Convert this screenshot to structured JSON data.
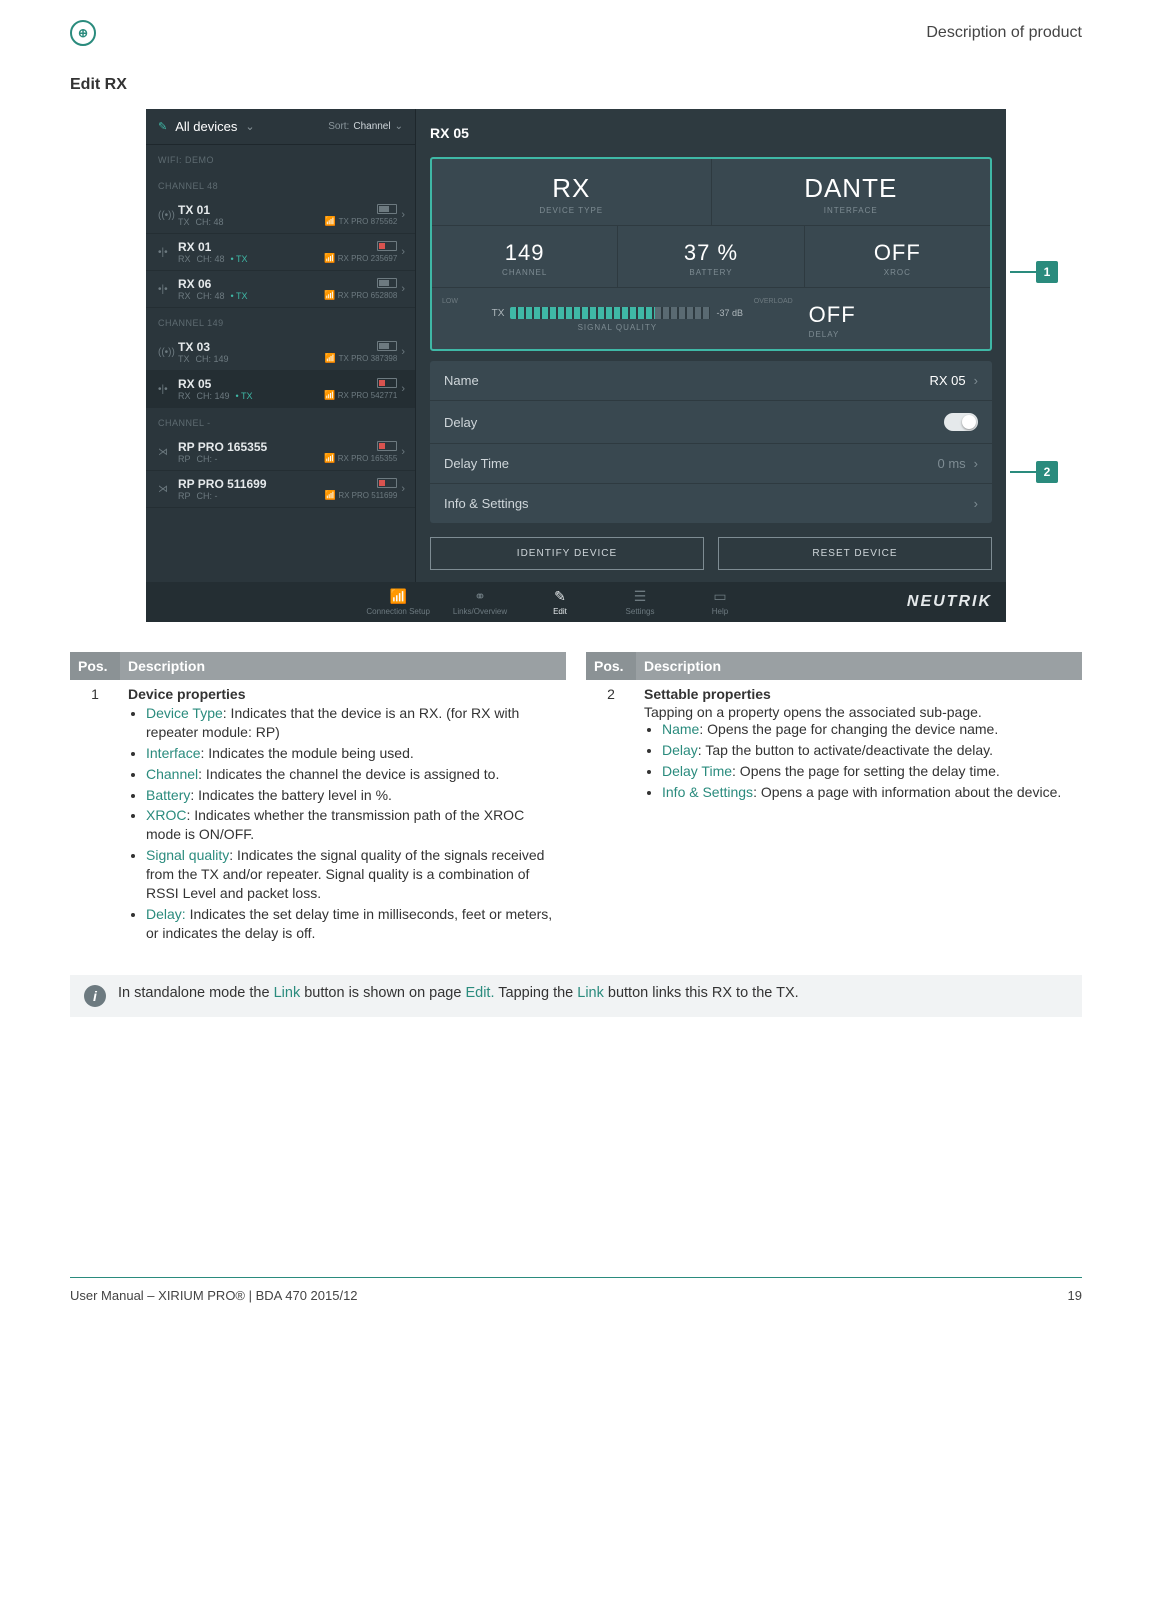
{
  "header": {
    "section": "Description of product",
    "subtitle": "Edit RX"
  },
  "app": {
    "all_devices": "All devices",
    "sort_label": "Sort:",
    "sort_value": "Channel",
    "wifi_label": "WIFI: DEMO",
    "groups": [
      {
        "label": "CHANNEL 48"
      },
      {
        "label": "CHANNEL 149"
      },
      {
        "label": "CHANNEL -"
      }
    ],
    "devices": {
      "g1": [
        {
          "icon": "((•))",
          "type": "TX",
          "name": "TX 01",
          "ch": "CH: 48",
          "wifi": "TX PRO 875562"
        },
        {
          "icon": "•|•",
          "type": "RX",
          "name": "RX 01",
          "ch": "CH: 48",
          "link": "• TX",
          "wifi": "RX PRO 235697"
        },
        {
          "icon": "•|•",
          "type": "RX",
          "name": "RX 06",
          "ch": "CH: 48",
          "link": "• TX",
          "wifi": "RX PRO 652808"
        }
      ],
      "g2": [
        {
          "icon": "((•))",
          "type": "TX",
          "name": "TX 03",
          "ch": "CH: 149",
          "wifi": "TX PRO 387398"
        },
        {
          "icon": "•|•",
          "type": "RX",
          "name": "RX 05",
          "ch": "CH: 149",
          "link": "• TX",
          "wifi": "RX PRO 542771",
          "selected": true
        }
      ],
      "g3": [
        {
          "icon": "⋊",
          "type": "RP",
          "name": "RP PRO 165355",
          "ch": "CH: -",
          "wifi": "RX PRO 165355"
        },
        {
          "icon": "⋊",
          "type": "RP",
          "name": "RP PRO 511699",
          "ch": "CH: -",
          "wifi": "RX PRO 511699"
        }
      ]
    },
    "main": {
      "title": "RX 05",
      "props": {
        "device_type": "RX",
        "device_type_label": "DEVICE TYPE",
        "interface": "DANTE",
        "interface_label": "INTERFACE",
        "channel": "149",
        "channel_label": "CHANNEL",
        "battery": "37 %",
        "battery_label": "BATTERY",
        "xroc": "OFF",
        "xroc_label": "XROC",
        "sq_low": "LOW",
        "sq_over": "OVERLOAD",
        "sq_tx": "TX",
        "sq_db": "-37 dB",
        "sq_label": "SIGNAL QUALITY",
        "delay": "OFF",
        "delay_label": "DELAY"
      },
      "rows": {
        "name_label": "Name",
        "name_value": "RX 05",
        "delay_label": "Delay",
        "delaytime_label": "Delay Time",
        "delaytime_value": "0 ms",
        "info_label": "Info & Settings"
      },
      "buttons": {
        "identify": "IDENTIFY DEVICE",
        "reset": "RESET DEVICE"
      }
    },
    "nav": {
      "conn": "Connection Setup",
      "links": "Links/Overview",
      "edit": "Edit",
      "settings": "Settings",
      "help": "Help",
      "brand": "NEUTRIK"
    }
  },
  "callouts": {
    "one": "1",
    "two": "2"
  },
  "table_headers": {
    "pos": "Pos.",
    "desc": "Description"
  },
  "desc1": {
    "pos": "1",
    "title": "Device properties",
    "items": [
      {
        "k": "Device Type",
        "v": ": Indicates that the device is an RX. (for RX with repeater module: RP)"
      },
      {
        "k": "Interface",
        "v": ": Indicates the module being used."
      },
      {
        "k": "Channel",
        "v": ": Indicates the channel the device is assigned to."
      },
      {
        "k": "Battery",
        "v": ": Indicates the battery level in %."
      },
      {
        "k": "XROC",
        "v": ": Indicates whether the transmission path of the XROC mode is ON/OFF."
      },
      {
        "k": "Signal quality",
        "v": ": Indicates the signal quality of the signals received from the TX and/or repeater. Signal quality is a combination of RSSI Level and packet loss."
      },
      {
        "k": "Delay:",
        "v": " Indicates the set delay time in milliseconds, feet or meters, or indicates the delay is off."
      }
    ]
  },
  "desc2": {
    "pos": "2",
    "title": "Settable properties",
    "intro": "Tapping on a property opens the associated sub-page.",
    "items": [
      {
        "k": "Name",
        "v": ": Opens the page for changing the device name."
      },
      {
        "k": "Delay",
        "v": ": Tap the button to activate/deactivate the delay."
      },
      {
        "k": "Delay Time",
        "v": ": Opens the page for setting the delay time."
      },
      {
        "k": "Info & Settings",
        "v": ": Opens a page with information about the device."
      }
    ]
  },
  "note": {
    "pre": "In standalone mode the ",
    "link1": "Link",
    "mid1": " button is shown on page ",
    "edit": "Edit.",
    "mid2": " Tapping the ",
    "link2": "Link",
    "post": " button links this RX to the TX."
  },
  "footer": {
    "left": "User Manual – XIRIUM PRO® | BDA 470 2015/12",
    "right": "19"
  }
}
